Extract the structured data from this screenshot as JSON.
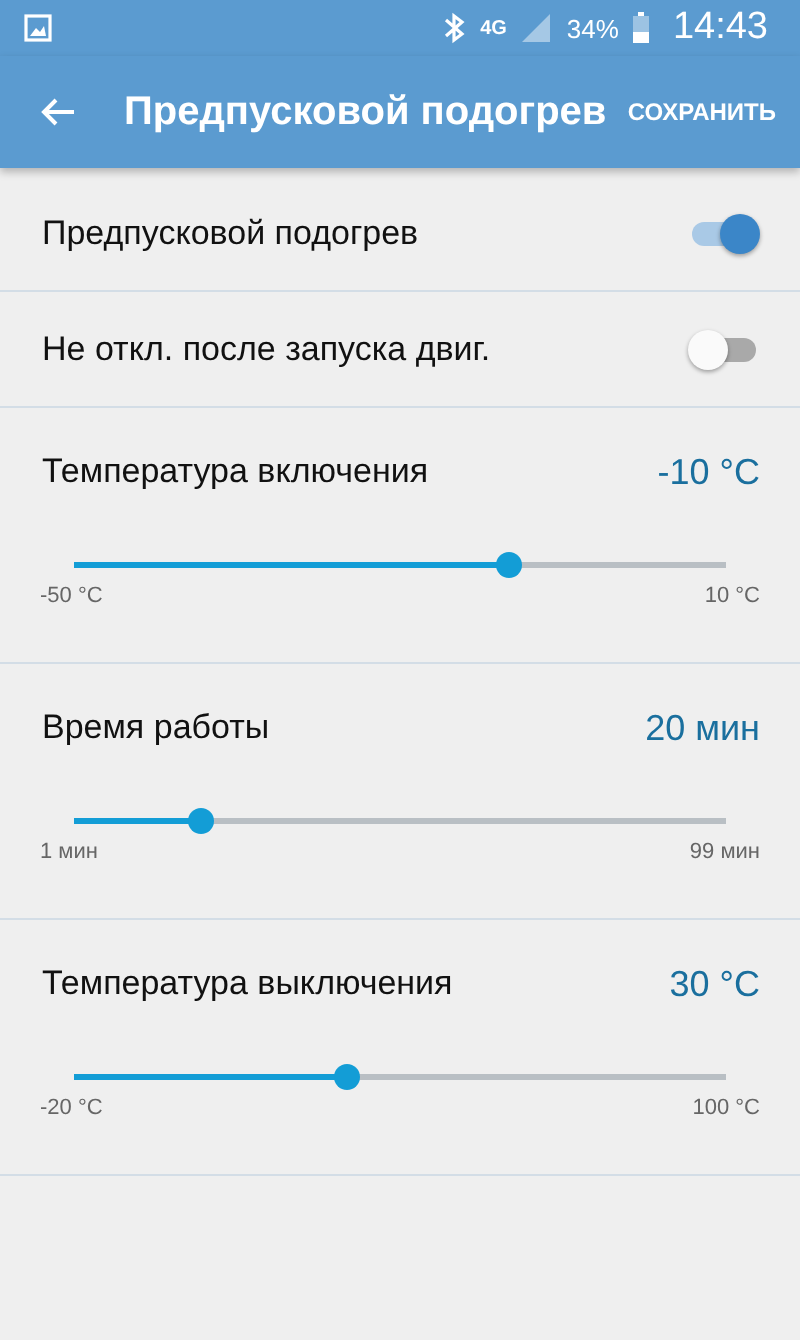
{
  "status_bar": {
    "network": "4G",
    "battery": "34%",
    "time": "14:43"
  },
  "app_bar": {
    "title": "Предпусковой подогрев",
    "action": "СОХРАНИТЬ"
  },
  "settings": [
    {
      "kind": "toggle",
      "label": "Предпусковой подогрев",
      "on": true
    },
    {
      "kind": "toggle",
      "label": "Не откл. после запуска двиг.",
      "on": false
    },
    {
      "kind": "slider",
      "label": "Температура включения",
      "reading": "-10 °C",
      "level": 0.667,
      "min": "-50 °C",
      "max": "10 °C"
    },
    {
      "kind": "slider",
      "label": "Время работы",
      "reading": "20 мин",
      "level": 0.194,
      "min": "1 мин",
      "max": "99 мин"
    },
    {
      "kind": "slider",
      "label": "Температура выключения",
      "reading": "30 °C",
      "level": 0.418,
      "min": "-20 °C",
      "max": "100 °C"
    }
  ]
}
